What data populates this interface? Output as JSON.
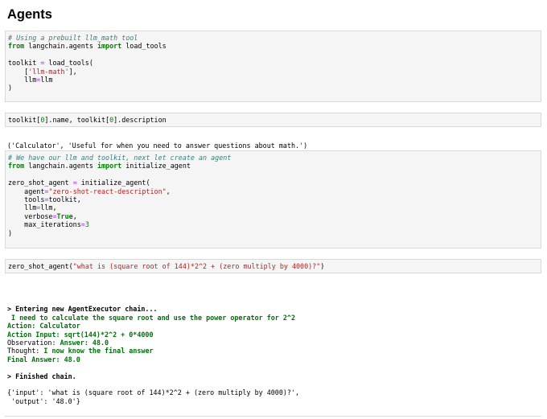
{
  "heading": "Agents",
  "cell1": {
    "comment": "# Using a prebuilt llm_math tool",
    "from_kw": "from",
    "from_mod": " langchain.agents ",
    "import_kw": "import",
    "import_name": " load_tools",
    "l3_a": "toolkit ",
    "l3_eq": "=",
    "l3_b": " load_tools(",
    "l4_indent": "    [",
    "l4_str": "'llm-math'",
    "l4_end": "],",
    "l5_a": "    llm",
    "l5_eq": "=",
    "l5_b": "llm",
    "l6": ")"
  },
  "cell2": {
    "a": "toolkit[",
    "n1": "0",
    "b": "].name, toolkit[",
    "n2": "0",
    "c": "].description"
  },
  "output1": "('Calculator', 'Useful for when you need to answer questions about math.')",
  "cell3": {
    "comment": "# We have our llm and toolkit, next let create an agent",
    "from_kw": "from",
    "from_mod": " langchain.agents ",
    "import_kw": "import",
    "import_name": " initialize_agent",
    "l3_a": "zero_shot_agent ",
    "l3_eq": "=",
    "l3_b": " initialize_agent(",
    "l4_a": "    agent",
    "l4_eq": "=",
    "l4_str": "\"zero-shot-react-description\"",
    "l4_end": ",",
    "l5_a": "    tools",
    "l5_eq": "=",
    "l5_b": "toolkit,",
    "l6_a": "    llm",
    "l6_eq": "=",
    "l6_b": "llm,",
    "l7_a": "    verbose",
    "l7_eq": "=",
    "l7_kw": "True",
    "l7_end": ",",
    "l8_a": "    max_iterations",
    "l8_eq": "=",
    "l8_num": "3",
    "l9": ")"
  },
  "cell4": {
    "a": "zero_shot_agent(",
    "str": "\"what is (square root of 144)*2^2 + (zero multiply by 4000)?\"",
    "b": ")"
  },
  "output2": {
    "entering": "> Entering new AgentExecutor chain...",
    "thought1": " I need to calculate the square root and use the power operator for 2^2",
    "action": "Action: Calculator",
    "action_input": "Action Input: sqrt(144)*2^2 + 0*4000",
    "obs_label": "Observation: ",
    "obs_value": "Answer: 48.0",
    "thought_label": "Thought: ",
    "thought_value": "I now know the final answer",
    "final": "Final Answer: 48.0",
    "finished": "> Finished chain.",
    "result_l1": "{'input': 'what is (square root of 144)*2^2 + (zero multiply by 4000)?',",
    "result_l2": " 'output': '48.0'}"
  }
}
